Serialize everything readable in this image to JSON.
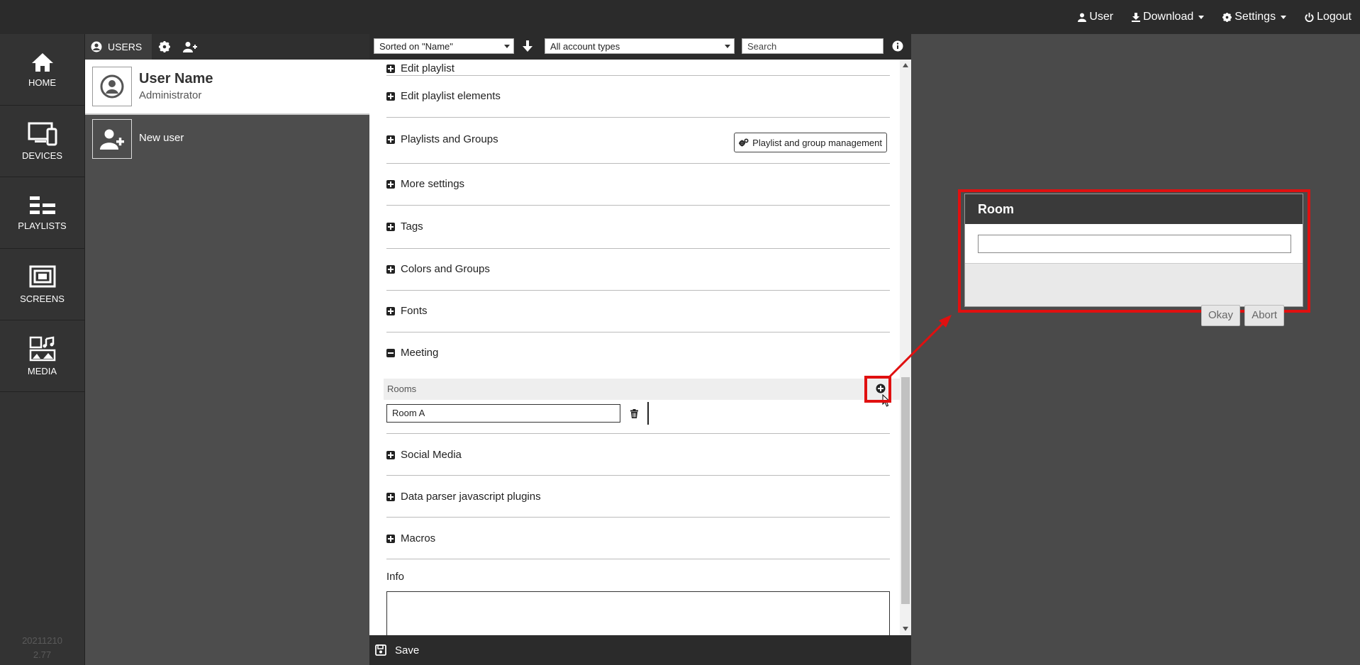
{
  "topmenu": {
    "user_label": "User",
    "download_label": "Download",
    "settings_label": "Settings",
    "logout_label": "Logout"
  },
  "nav": {
    "items": [
      {
        "label": "HOME",
        "icon": "home-icon"
      },
      {
        "label": "DEVICES",
        "icon": "devices-icon"
      },
      {
        "label": "PLAYLISTS",
        "icon": "playlists-icon"
      },
      {
        "label": "SCREENS",
        "icon": "screens-icon"
      },
      {
        "label": "MEDIA",
        "icon": "media-icon"
      }
    ],
    "version_date": "20211210",
    "version_number": "2.77"
  },
  "userpanel": {
    "tab_label": "USERS",
    "current_user": {
      "name": "User Name",
      "role": "Administrator"
    },
    "new_user_label": "New user"
  },
  "filters": {
    "sort_value": "Sorted on \"Name\"",
    "account_type_value": "All account types",
    "search_placeholder": "Search"
  },
  "detail": {
    "sections": [
      {
        "label": "Edit playlist",
        "expanded": false
      },
      {
        "label": "Edit playlist elements",
        "expanded": false
      },
      {
        "label": "Playlists and Groups",
        "expanded": false
      },
      {
        "label": "More settings",
        "expanded": false
      },
      {
        "label": "Tags",
        "expanded": false
      },
      {
        "label": "Colors and Groups",
        "expanded": false
      },
      {
        "label": "Fonts",
        "expanded": false
      },
      {
        "label": "Meeting",
        "expanded": true
      },
      {
        "label": "Social Media",
        "expanded": false
      },
      {
        "label": "Data parser javascript plugins",
        "expanded": false
      },
      {
        "label": "Macros",
        "expanded": false
      }
    ],
    "playlist_group_button": "Playlist and group management",
    "meeting": {
      "rooms_label": "Rooms",
      "rooms": [
        "Room A"
      ]
    },
    "info_label": "Info",
    "save_label": "Save"
  },
  "dialog": {
    "title": "Room",
    "input_value": "",
    "okay_label": "Okay",
    "abort_label": "Abort"
  },
  "colors": {
    "highlight": "#e01010",
    "topbar": "#2b2b2b",
    "nav_bg": "#333333"
  }
}
